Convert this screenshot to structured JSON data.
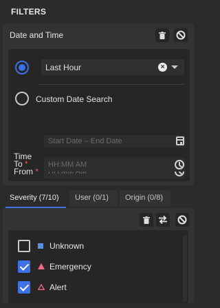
{
  "panel": {
    "title": "FILTERS"
  },
  "date_time": {
    "title": "Date and Time",
    "delete_icon": "trash-icon",
    "reset_icon": "ban-icon",
    "options": [
      {
        "label": "Last Hour",
        "selected": true,
        "kind": "preset"
      },
      {
        "label": "Custom Date Search",
        "selected": false,
        "kind": "custom"
      }
    ],
    "range_placeholder": "Start Date – End Date",
    "time_heading": "Time",
    "from_label": "From",
    "to_label": "To",
    "required_mark": "*",
    "from_placeholder": "HH:MM AM",
    "to_placeholder": "HH:MM AM",
    "clear_glyph": "×"
  },
  "tabs": [
    {
      "label": "Severity (7/10)",
      "active": true
    },
    {
      "label": "User (0/1)",
      "active": false
    },
    {
      "label": "Origin (0/8)",
      "active": false
    }
  ],
  "severity": {
    "toolbar_icons": [
      "trash-icon",
      "swap-icon",
      "ban-icon"
    ],
    "items": [
      {
        "label": "Unknown",
        "checked": false,
        "icon": "square-icon",
        "color": "#5b8fd9"
      },
      {
        "label": "Emergency",
        "checked": true,
        "icon": "triangle-filled-icon",
        "color": "#f06b8a"
      },
      {
        "label": "Alert",
        "checked": true,
        "icon": "triangle-outline-icon",
        "color": "#f06b8a"
      }
    ]
  },
  "colors": {
    "accent": "#3d71e6",
    "required": "#f05a5a"
  }
}
